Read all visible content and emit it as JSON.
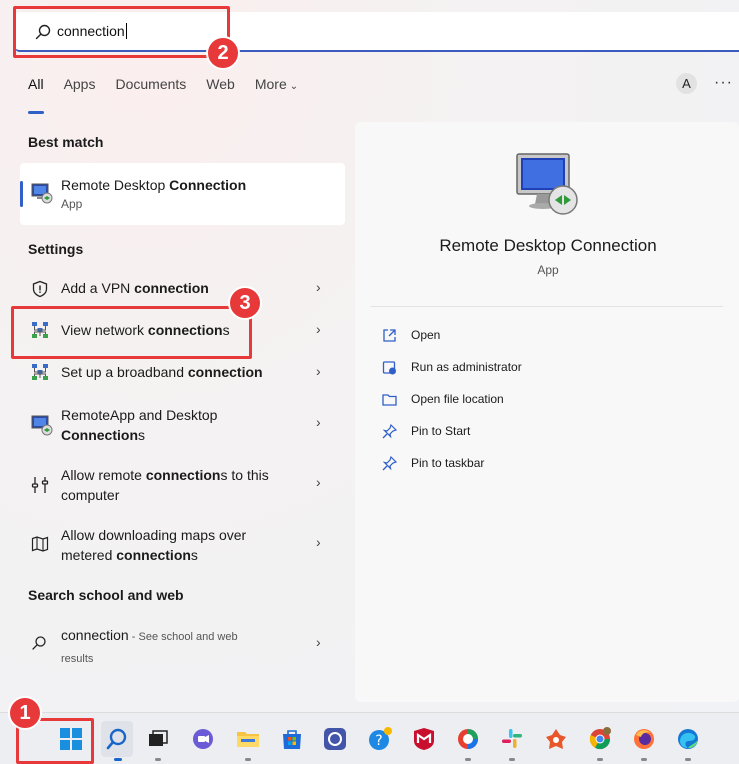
{
  "search": {
    "value": "connection"
  },
  "tabs": [
    {
      "label": "All"
    },
    {
      "label": "Apps"
    },
    {
      "label": "Documents"
    },
    {
      "label": "Web"
    },
    {
      "label": "More"
    }
  ],
  "account": {
    "avatar_letter": "A"
  },
  "best_match": {
    "header": "Best match",
    "title_prefix": "Remote Desktop ",
    "title_bold": "Connection",
    "subtitle": "App"
  },
  "settings": {
    "header": "Settings",
    "items": [
      {
        "pre": "Add a VPN ",
        "bold": "connection",
        "post": ""
      },
      {
        "pre": "View network ",
        "bold": "connection",
        "post": "s"
      },
      {
        "pre": "Set up a broadband ",
        "bold": "connection",
        "post": ""
      },
      {
        "pre": "RemoteApp and Desktop",
        "bold2": "Connection",
        "post2": "s"
      },
      {
        "pre": "Allow remote ",
        "bold": "connection",
        "post": "s to this",
        "line2": "computer"
      },
      {
        "pre": "Allow downloading maps over",
        "pre2": "metered ",
        "bold2": "connection",
        "post2": "s"
      }
    ]
  },
  "web": {
    "header": "Search school and web",
    "query": "connection",
    "suffix": " - See school and web",
    "line2": "results"
  },
  "preview": {
    "title": "Remote Desktop Connection",
    "subtitle": "App",
    "actions": [
      {
        "label": "Open",
        "icon": "open-icon"
      },
      {
        "label": "Run as administrator",
        "icon": "shield-icon"
      },
      {
        "label": "Open file location",
        "icon": "folder-icon"
      },
      {
        "label": "Pin to Start",
        "icon": "pin-icon"
      },
      {
        "label": "Pin to taskbar",
        "icon": "pin-icon"
      }
    ]
  },
  "annotations": [
    "1",
    "2",
    "3"
  ],
  "colors": {
    "accent": "#2f5fc7",
    "annotation": "#e8393a"
  }
}
